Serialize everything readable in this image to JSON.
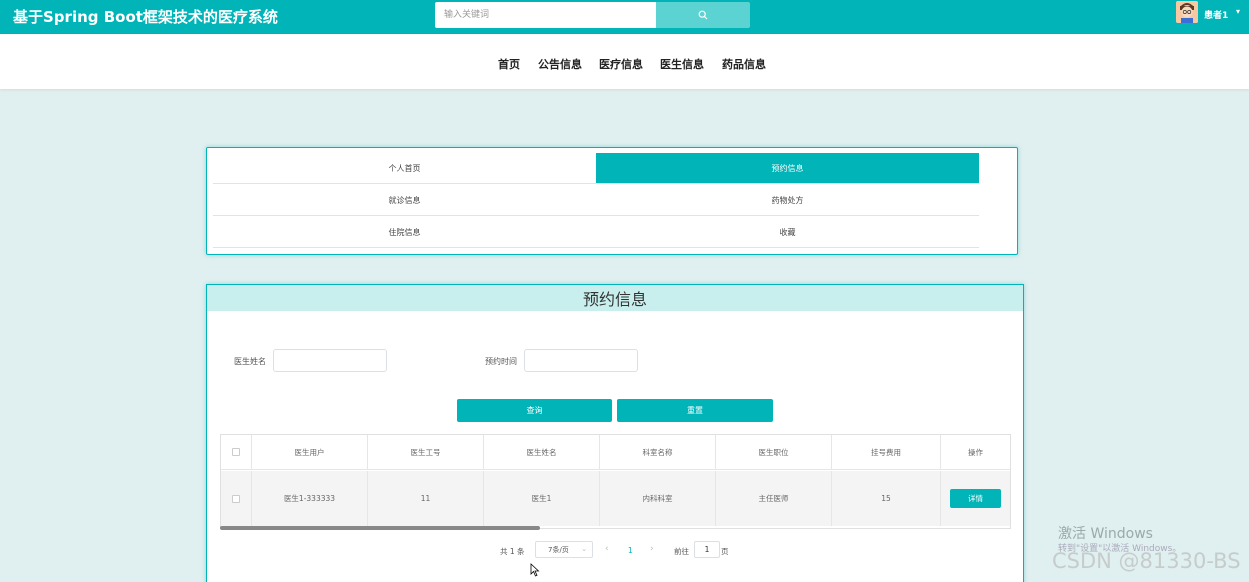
{
  "header": {
    "title": "基于Spring Boot框架技术的医疗系统",
    "search_placeholder": "输入关键词",
    "user_name": "患者1",
    "user_caret": "▾"
  },
  "nav": {
    "items": [
      "首页",
      "公告信息",
      "医疗信息",
      "医生信息",
      "药品信息"
    ]
  },
  "center_menu": {
    "items": [
      {
        "label": "个人首页",
        "active": false
      },
      {
        "label": "预约信息",
        "active": true
      },
      {
        "label": "就诊信息",
        "active": false
      },
      {
        "label": "药物处方",
        "active": false
      },
      {
        "label": "住院信息",
        "active": false
      },
      {
        "label": "收藏",
        "active": false
      }
    ]
  },
  "panel": {
    "title": "预约信息",
    "filters": {
      "doctor_name_label": "医生姓名",
      "doctor_name_value": "",
      "appt_time_label": "预约时间",
      "appt_time_value": ""
    },
    "query_button": "查询",
    "reset_button": "重置"
  },
  "table": {
    "headers": [
      "医生用户",
      "医生工号",
      "医生姓名",
      "科室名称",
      "医生职位",
      "挂号费用",
      "操作"
    ],
    "rows": [
      {
        "doctor_user": "医生1-333333",
        "doctor_id": "11",
        "doctor_name": "医生1",
        "department": "内科科室",
        "position": "主任医师",
        "fee": "15",
        "action": "详情"
      }
    ]
  },
  "pagination": {
    "total": "共 1 条",
    "page_size": "7条/页",
    "current_page": "1",
    "goto_label": "前往",
    "goto_value": "1",
    "page_suffix": "页",
    "prev": "‹",
    "next": "›"
  },
  "watermark": {
    "line1": "激活 Windows",
    "line2": "转到\"设置\"以激活 Windows。",
    "line3": "CSDN @81330-BS"
  },
  "colors": {
    "primary": "#00b4b8",
    "panel_header": "#c8eeee",
    "page_background": "#e0efef"
  }
}
